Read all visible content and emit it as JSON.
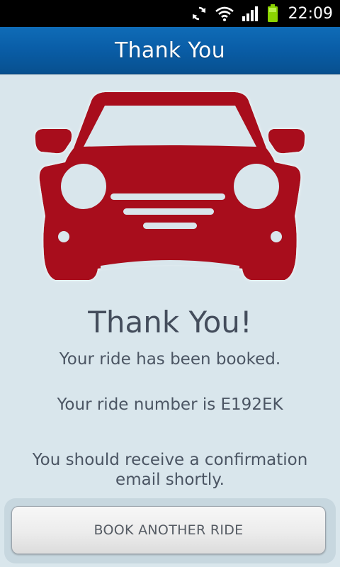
{
  "status_bar": {
    "time": "22:09",
    "icons": [
      "sync-icon",
      "wifi-icon",
      "signal-icon",
      "battery-icon"
    ]
  },
  "header": {
    "title": "Thank You"
  },
  "main": {
    "image": "car-icon",
    "heading": "Thank You!",
    "booked_message": "Your ride has been booked.",
    "ride_number_message": "Your ride number is E192EK",
    "confirmation_message": "You should receive a confirmation email shortly."
  },
  "actions": {
    "book_another_label": "BOOK ANOTHER RIDE"
  },
  "colors": {
    "title_bar": "#0a5ea8",
    "background": "#d9e6ec",
    "car": "#a8101a",
    "heading_text": "#444d5c"
  }
}
